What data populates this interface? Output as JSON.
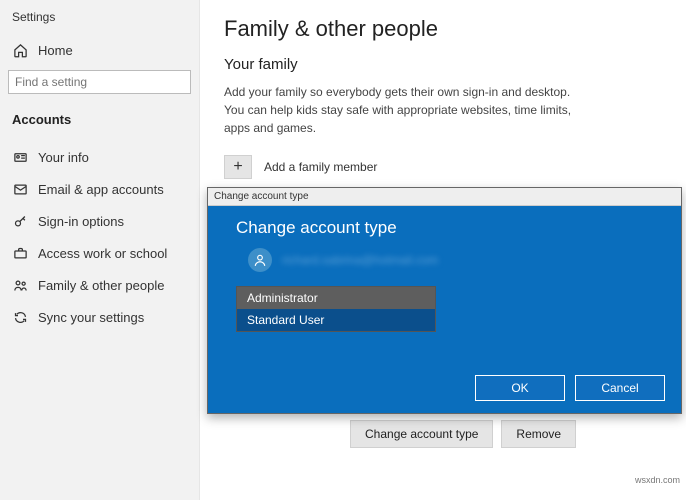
{
  "app_title": "Settings",
  "sidebar": {
    "home_label": "Home",
    "search_placeholder": "Find a setting",
    "section_heading": "Accounts",
    "items": [
      {
        "label": "Your info"
      },
      {
        "label": "Email & app accounts"
      },
      {
        "label": "Sign-in options"
      },
      {
        "label": "Access work or school"
      },
      {
        "label": "Family & other people"
      },
      {
        "label": "Sync your settings"
      }
    ]
  },
  "main": {
    "title": "Family & other people",
    "subtitle": "Your family",
    "body": "Add your family so everybody gets their own sign-in and desktop. You can help kids stay safe with appropriate websites, time limits, apps and games.",
    "add_member_label": "Add a family member",
    "change_type_btn": "Change account type",
    "remove_btn": "Remove"
  },
  "dialog": {
    "titlebar": "Change account type",
    "heading": "Change account type",
    "user_email": "richard.sabrina@hotmail.com",
    "options": {
      "admin": "Administrator",
      "standard": "Standard User"
    },
    "ok": "OK",
    "cancel": "Cancel"
  },
  "watermark": "wsxdn.com"
}
